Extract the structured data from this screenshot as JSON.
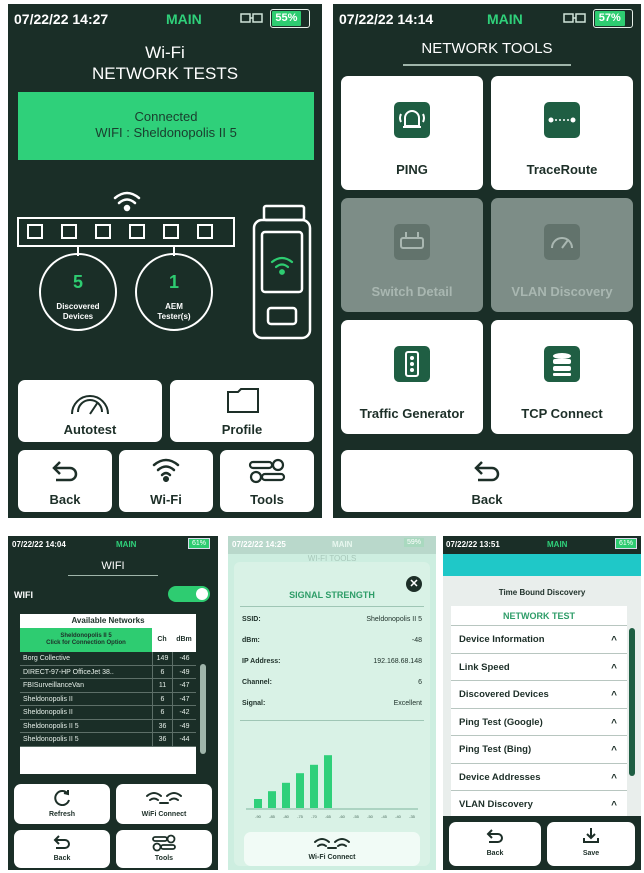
{
  "panel_main": {
    "time": "07/22/22 14:27",
    "mode": "MAIN",
    "battery": "55%",
    "title_line1": "Wi-Fi",
    "title_line2": "NETWORK TESTS",
    "connection_status": "Connected",
    "connection_network": "WIFI : Sheldonopolis II 5",
    "discovered_count": "5",
    "discovered_label_line1": "Discovered",
    "discovered_label_line2": "Devices",
    "aem_count": "1",
    "aem_label_line1": "AEM",
    "aem_label_line2": "Tester(s)",
    "autotest_label": "Autotest",
    "profile_label": "Profile",
    "back_label": "Back",
    "wifi_label": "Wi-Fi",
    "tools_label": "Tools"
  },
  "panel_tools": {
    "time": "07/22/22 14:14",
    "mode": "MAIN",
    "battery": "57%",
    "title": "NETWORK TOOLS",
    "items": [
      {
        "label": "PING",
        "icon": "ping-bell-icon",
        "enabled": true
      },
      {
        "label": "TraceRoute",
        "icon": "traceroute-icon",
        "enabled": true
      },
      {
        "label": "Switch Detail",
        "icon": "switch-icon",
        "enabled": false
      },
      {
        "label": "VLAN Discovery",
        "icon": "vlan-gauge-icon",
        "enabled": false
      },
      {
        "label": "Traffic Generator",
        "icon": "traffic-light-icon",
        "enabled": true
      },
      {
        "label": "TCP Connect",
        "icon": "database-icon",
        "enabled": true
      }
    ],
    "back_label": "Back"
  },
  "panel_wifi": {
    "time": "07/22/22 14:04",
    "mode": "MAIN",
    "battery": "61%",
    "title": "WIFI",
    "wifi_label": "WIFI",
    "table_title": "Available Networks",
    "header_name_line1": "Sheldonopolis II 5",
    "header_name_line2": "Click for Connection Option",
    "header_ch": "Ch",
    "header_dbm": "dBm",
    "rows": [
      {
        "name": "Borg Collective",
        "ch": "149",
        "dbm": "-46"
      },
      {
        "name": "DIRECT-97-HP OfficeJet 38..",
        "ch": "6",
        "dbm": "-49"
      },
      {
        "name": "FBISurveillanceVan",
        "ch": "11",
        "dbm": "-47"
      },
      {
        "name": "Sheldonopolis II",
        "ch": "6",
        "dbm": "-47"
      },
      {
        "name": "Sheldonopolis II",
        "ch": "6",
        "dbm": "-42"
      },
      {
        "name": "Sheldonopolis II 5",
        "ch": "36",
        "dbm": "-49"
      },
      {
        "name": "Sheldonopolis II 5",
        "ch": "36",
        "dbm": "-44"
      }
    ],
    "refresh_label": "Refresh",
    "wifi_connect_label": "WiFi Connect",
    "back_label": "Back",
    "tools_label": "Tools"
  },
  "panel_signal": {
    "time": "07/22/22 14:25",
    "mode": "MAIN",
    "battery": "59%",
    "header_partial": "WI-FI TOOLS",
    "title": "SIGNAL STRENGTH",
    "ssid_label": "SSID:",
    "ssid_value": "Sheldonopolis II 5",
    "dbm_label": "dBm:",
    "dbm_value": "-48",
    "ip_label": "IP Address:",
    "ip_value": "192.168.68.148",
    "channel_label": "Channel:",
    "channel_value": "6",
    "signal_label": "Signal:",
    "signal_value": "Excellent",
    "bar_levels": [
      0.15,
      0.28,
      0.42,
      0.58,
      0.72,
      0.88
    ],
    "x_ticks": [
      "-90",
      "-85",
      "-80",
      "-75",
      "-70",
      "-65",
      "-60",
      "-55",
      "-50",
      "-45",
      "-40",
      "-35"
    ],
    "wifi_connect_label": "Wi-Fi Connect"
  },
  "panel_discovery": {
    "time": "07/22/22 13:51",
    "mode": "MAIN",
    "battery": "61%",
    "subtitle": "Time Bound Discovery",
    "section_title": "NETWORK TEST",
    "items": [
      "Device Information",
      "Link Speed",
      "Discovered Devices",
      "Ping Test (Google)",
      "Ping Test (Bing)",
      "Device Addresses",
      "VLAN Discovery"
    ],
    "back_label": "Back",
    "save_label": "Save"
  },
  "colors": {
    "dark_bg": "#1a2e27",
    "accent_green": "#2ecc71",
    "banner_green": "#2fd07a",
    "teal": "#1fc8c8"
  }
}
